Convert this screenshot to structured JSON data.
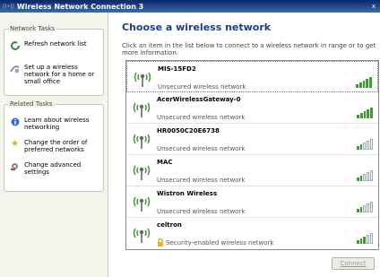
{
  "window": {
    "title": "Wireless Network Connection 3",
    "title_icon": "wireless-icon",
    "close_label": "x"
  },
  "sidebar": {
    "network_tasks": {
      "header": "Network Tasks",
      "items": [
        {
          "label": "Refresh network list",
          "icon": "refresh-icon"
        },
        {
          "label": "Set up a wireless network for a home or small office",
          "icon": "setup-wizard-icon"
        }
      ]
    },
    "related_tasks": {
      "header": "Related Tasks",
      "items": [
        {
          "label": "Learn about wireless networking",
          "icon": "info-icon"
        },
        {
          "label": "Change the order of preferred networks",
          "icon": "star-icon"
        },
        {
          "label": "Change advanced settings",
          "icon": "settings-icon"
        }
      ]
    }
  },
  "main": {
    "title": "Choose a wireless network",
    "description": "Click an item in the list below to connect to a wireless network in range or to get more information."
  },
  "networks": [
    {
      "name": "MIS-15FD2",
      "status": "Unsecured wireless network",
      "secured": false,
      "signal": 5
    },
    {
      "name": "AcerWirelessGateway-0",
      "status": "Unsecured wireless network",
      "secured": false,
      "signal": 5
    },
    {
      "name": "HR0050C20E6738",
      "status": "Unsecured wireless network",
      "secured": false,
      "signal": 2
    },
    {
      "name": "MAC",
      "status": "Unsecured wireless network",
      "secured": false,
      "signal": 2
    },
    {
      "name": "Wistron Wireless",
      "status": "Unsecured wireless network",
      "secured": false,
      "signal": 2
    },
    {
      "name": "celtron",
      "status": "Security-enabled wireless network",
      "secured": true,
      "signal": 3
    }
  ],
  "buttons": {
    "connect": "Connect"
  },
  "colors": {
    "title_blue": "#1b3c8e",
    "signal_green": "#3e9d2f"
  }
}
